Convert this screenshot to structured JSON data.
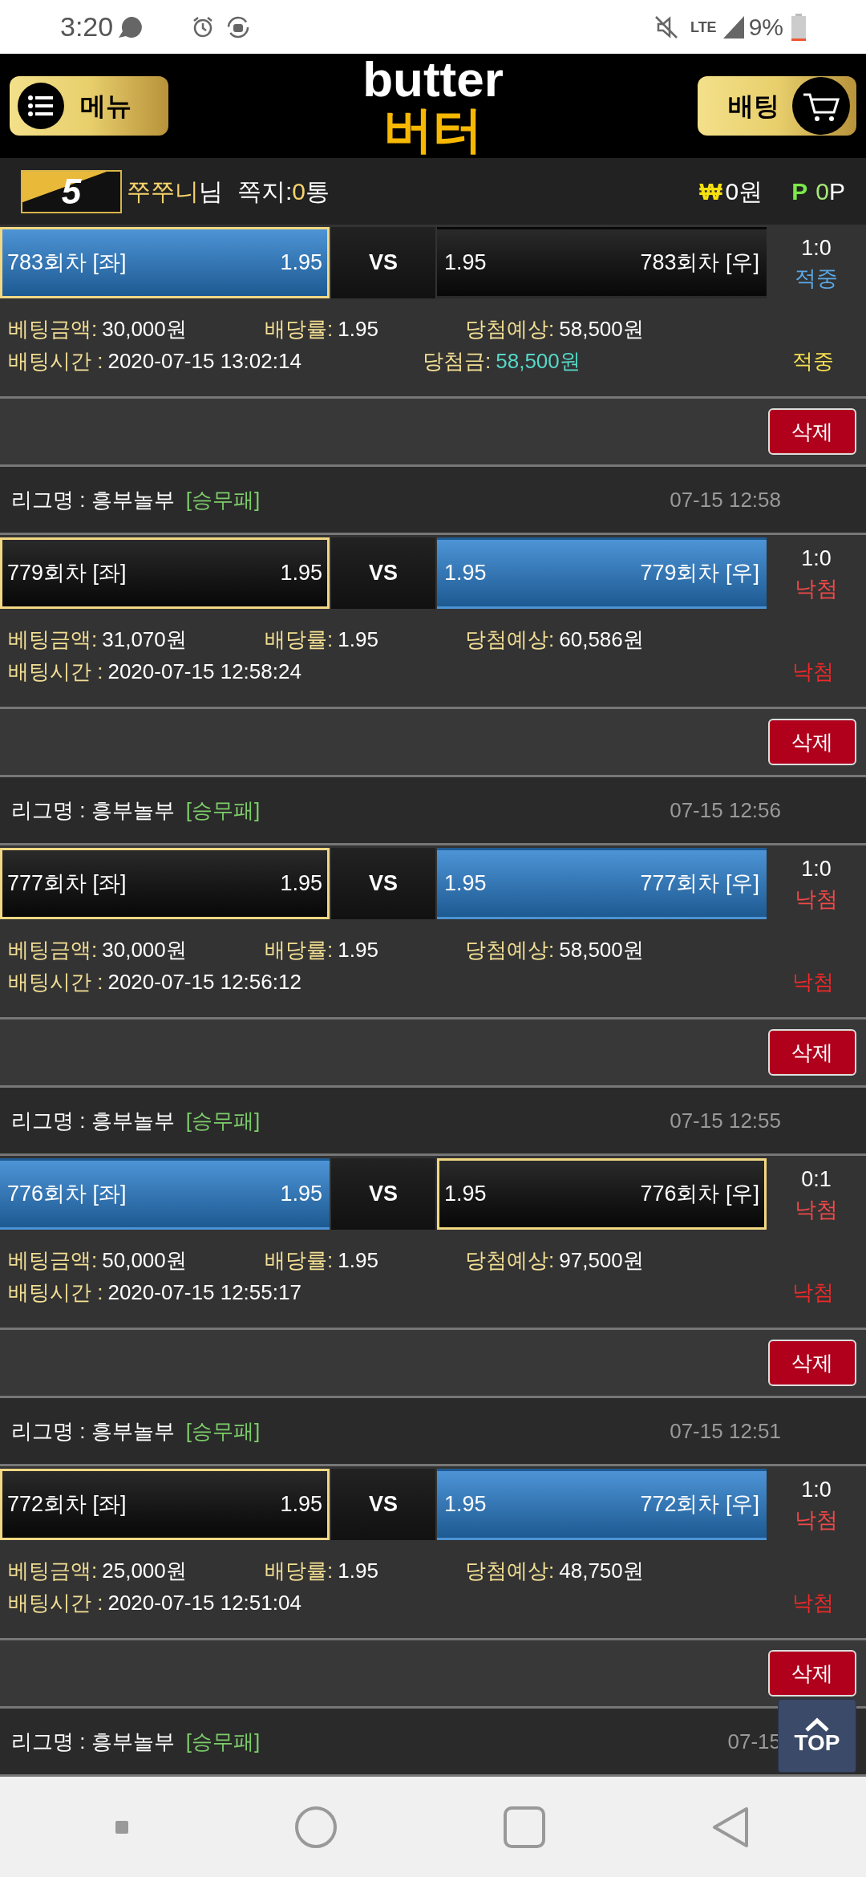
{
  "status_bar": {
    "time": "3:20",
    "network": "LTE",
    "battery": "9%"
  },
  "header": {
    "menu_button": "메뉴",
    "logo_top": "butter",
    "logo_bottom": "버터",
    "bet_button": "배팅"
  },
  "user_bar": {
    "level": "5",
    "nickname": "쭈쭈니",
    "suffix": "님",
    "messages_label": "쪽지:",
    "messages_count": "0",
    "messages_unit": "통",
    "currency": "₩",
    "cash": "0원",
    "points_mark": "P",
    "points_value": "0",
    "points_unit": "P"
  },
  "bets": [
    {
      "match": {
        "left": {
          "name": "783회차 [좌]",
          "odds": "1.95",
          "picked": true,
          "won": true
        },
        "vs": "VS",
        "right": {
          "name": "783회차 [우]",
          "odds": "1.95",
          "picked": false,
          "won": false
        }
      },
      "score": "1:0",
      "result": {
        "kind": "win",
        "label": "적중"
      },
      "details": [
        {
          "label": "베팅금액:",
          "value": "30,000원"
        },
        {
          "label": "배당률:",
          "value": "1.95"
        },
        {
          "label": "당첨예상:",
          "value": "58,500원"
        }
      ],
      "bet_time": {
        "label": "배팅시간 :",
        "value": "2020-07-15 13:02:14"
      },
      "payout": {
        "label": "당첨금:",
        "value": "58,500원"
      },
      "status": {
        "kind": "win",
        "label": "적중"
      },
      "delete_button": "삭제"
    },
    {
      "league": {
        "label": "리그명 : 흥부놀부",
        "type": "[승무패]",
        "time": "07-15 12:58"
      },
      "match": {
        "left": {
          "name": "779회차 [좌]",
          "odds": "1.95",
          "picked": true,
          "won": false
        },
        "vs": "VS",
        "right": {
          "name": "779회차 [우]",
          "odds": "1.95",
          "picked": false,
          "won": true
        }
      },
      "score": "1:0",
      "result": {
        "kind": "lose",
        "label": "낙첨"
      },
      "details": [
        {
          "label": "베팅금액:",
          "value": "31,070원"
        },
        {
          "label": "배당률:",
          "value": "1.95"
        },
        {
          "label": "당첨예상:",
          "value": "60,586원"
        }
      ],
      "bet_time": {
        "label": "배팅시간 :",
        "value": "2020-07-15 12:58:24"
      },
      "status": {
        "kind": "lose",
        "label": "낙첨"
      },
      "delete_button": "삭제"
    },
    {
      "league": {
        "label": "리그명 : 흥부놀부",
        "type": "[승무패]",
        "time": "07-15 12:56"
      },
      "match": {
        "left": {
          "name": "777회차 [좌]",
          "odds": "1.95",
          "picked": true,
          "won": false
        },
        "vs": "VS",
        "right": {
          "name": "777회차 [우]",
          "odds": "1.95",
          "picked": false,
          "won": true
        }
      },
      "score": "1:0",
      "result": {
        "kind": "lose",
        "label": "낙첨"
      },
      "details": [
        {
          "label": "베팅금액:",
          "value": "30,000원"
        },
        {
          "label": "배당률:",
          "value": "1.95"
        },
        {
          "label": "당첨예상:",
          "value": "58,500원"
        }
      ],
      "bet_time": {
        "label": "배팅시간 :",
        "value": "2020-07-15 12:56:12"
      },
      "status": {
        "kind": "lose",
        "label": "낙첨"
      },
      "delete_button": "삭제"
    },
    {
      "league": {
        "label": "리그명 : 흥부놀부",
        "type": "[승무패]",
        "time": "07-15 12:55"
      },
      "match": {
        "left": {
          "name": "776회차 [좌]",
          "odds": "1.95",
          "picked": false,
          "won": true
        },
        "vs": "VS",
        "right": {
          "name": "776회차 [우]",
          "odds": "1.95",
          "picked": true,
          "won": false
        }
      },
      "score": "0:1",
      "result": {
        "kind": "lose",
        "label": "낙첨"
      },
      "details": [
        {
          "label": "베팅금액:",
          "value": "50,000원"
        },
        {
          "label": "배당률:",
          "value": "1.95"
        },
        {
          "label": "당첨예상:",
          "value": "97,500원"
        }
      ],
      "bet_time": {
        "label": "배팅시간 :",
        "value": "2020-07-15 12:55:17"
      },
      "status": {
        "kind": "lose",
        "label": "낙첨"
      },
      "delete_button": "삭제"
    },
    {
      "league": {
        "label": "리그명 : 흥부놀부",
        "type": "[승무패]",
        "time": "07-15 12:51"
      },
      "match": {
        "left": {
          "name": "772회차 [좌]",
          "odds": "1.95",
          "picked": true,
          "won": false
        },
        "vs": "VS",
        "right": {
          "name": "772회차 [우]",
          "odds": "1.95",
          "picked": false,
          "won": true
        }
      },
      "score": "1:0",
      "result": {
        "kind": "lose",
        "label": "낙첨"
      },
      "details": [
        {
          "label": "베팅금액:",
          "value": "25,000원"
        },
        {
          "label": "배당률:",
          "value": "1.95"
        },
        {
          "label": "당첨예상:",
          "value": "48,750원"
        }
      ],
      "bet_time": {
        "label": "배팅시간 :",
        "value": "2020-07-15 12:51:04"
      },
      "status": {
        "kind": "lose",
        "label": "낙첨"
      },
      "delete_button": "삭제"
    },
    {
      "league": {
        "label": "리그명 : 흥부놀부",
        "type": "[승무패]",
        "time": "07-15"
      }
    }
  ],
  "top_button": "TOP"
}
